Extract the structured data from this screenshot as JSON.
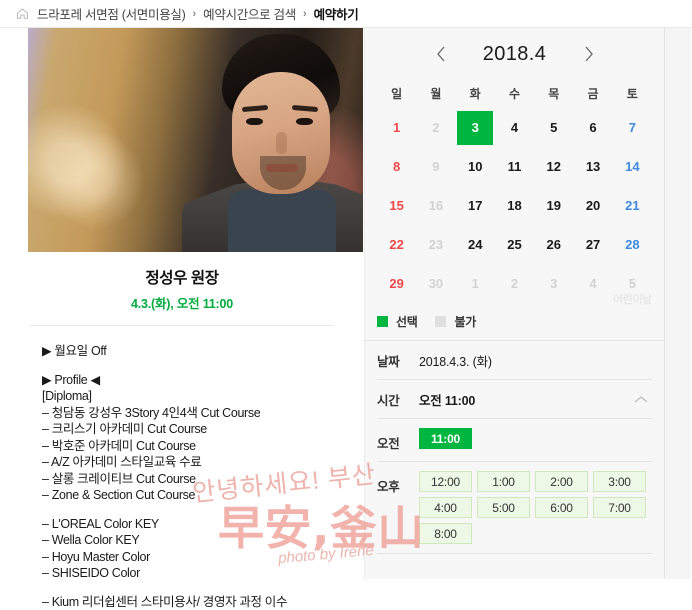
{
  "breadcrumb": {
    "home_icon": "home-icon",
    "separator": "›",
    "items": [
      {
        "label": "드라포레 서면점 (서면미용실)",
        "current": false
      },
      {
        "label": "예약시간으로 검색",
        "current": false
      },
      {
        "label": "예약하기",
        "current": true
      }
    ]
  },
  "stylist": {
    "photo_alt": "stylist-portrait",
    "name": "정성우 원장",
    "selected_slot": "4.3.(화), 오전 11:00",
    "notice": "▶ 월요일 Off",
    "profile_heading": "▶ Profile ◀",
    "profile_lines": [
      "[Diploma]",
      "– 청담동 강성우 3Story 4인4색 Cut Course",
      "– 크리스기 아카데미 Cut Course",
      "– 박호준 아카데미 Cut Course",
      "– A/Z 아카데미 스타일교육 수료",
      "– 살롱 크레이티브 Cut Course",
      "– Zone & Section Cut Course",
      "",
      "– L'OREAL Color KEY",
      "– Wella Color KEY",
      "– Hoyu Master Color",
      "– SHISEIDO Color",
      "",
      "– Kium 리더쉽센터 스타미용사/ 경영자 과정 이수"
    ]
  },
  "watermark": {
    "line_korean": "안녕하세요! 부산",
    "line_chinese": "早安,釜山",
    "line_credit": "photo by Irene"
  },
  "calendar": {
    "prev_icon": "chevron-left-icon",
    "next_icon": "chevron-right-icon",
    "title": "2018.4",
    "day_headers": [
      "일",
      "월",
      "화",
      "수",
      "목",
      "금",
      "토"
    ],
    "weeks": [
      [
        {
          "day": "1",
          "state": "sun"
        },
        {
          "day": "2",
          "state": "dim"
        },
        {
          "day": "3",
          "state": "sel"
        },
        {
          "day": "4",
          "state": "norm"
        },
        {
          "day": "5",
          "state": "norm"
        },
        {
          "day": "6",
          "state": "norm"
        },
        {
          "day": "7",
          "state": "sat"
        }
      ],
      [
        {
          "day": "8",
          "state": "sun"
        },
        {
          "day": "9",
          "state": "dim"
        },
        {
          "day": "10",
          "state": "norm"
        },
        {
          "day": "11",
          "state": "norm"
        },
        {
          "day": "12",
          "state": "norm"
        },
        {
          "day": "13",
          "state": "norm"
        },
        {
          "day": "14",
          "state": "sat"
        }
      ],
      [
        {
          "day": "15",
          "state": "sun"
        },
        {
          "day": "16",
          "state": "dim"
        },
        {
          "day": "17",
          "state": "norm"
        },
        {
          "day": "18",
          "state": "norm"
        },
        {
          "day": "19",
          "state": "norm"
        },
        {
          "day": "20",
          "state": "norm"
        },
        {
          "day": "21",
          "state": "sat"
        }
      ],
      [
        {
          "day": "22",
          "state": "sun"
        },
        {
          "day": "23",
          "state": "dim"
        },
        {
          "day": "24",
          "state": "norm"
        },
        {
          "day": "25",
          "state": "norm"
        },
        {
          "day": "26",
          "state": "norm"
        },
        {
          "day": "27",
          "state": "norm"
        },
        {
          "day": "28",
          "state": "sat"
        }
      ],
      [
        {
          "day": "29",
          "state": "sun"
        },
        {
          "day": "30",
          "state": "dim"
        },
        {
          "day": "1",
          "state": "dim"
        },
        {
          "day": "2",
          "state": "dim"
        },
        {
          "day": "3",
          "state": "dim"
        },
        {
          "day": "4",
          "state": "dim"
        },
        {
          "day": "5",
          "state": "dim",
          "holiday": "어린이날"
        }
      ]
    ],
    "legend": [
      {
        "swatch": "sel",
        "label": "선택"
      },
      {
        "swatch": "dis",
        "label": "불가"
      }
    ]
  },
  "booking": {
    "date_label": "날짜",
    "date_value": "2018.4.3. (화)",
    "time_label": "시간",
    "time_value": "오전 11:00",
    "collapse_icon": "chevron-up-icon",
    "am_label": "오전",
    "am_slots": [
      {
        "time": "11:00",
        "state": "sel"
      }
    ],
    "pm_label": "오후",
    "pm_slots": [
      {
        "time": "12:00",
        "state": "avail"
      },
      {
        "time": "1:00",
        "state": "avail"
      },
      {
        "time": "2:00",
        "state": "avail"
      },
      {
        "time": "3:00",
        "state": "avail"
      },
      {
        "time": "4:00",
        "state": "avail"
      },
      {
        "time": "5:00",
        "state": "avail"
      },
      {
        "time": "6:00",
        "state": "avail"
      },
      {
        "time": "7:00",
        "state": "avail"
      },
      {
        "time": "8:00",
        "state": "avail"
      }
    ]
  },
  "colors": {
    "accent_green": "#00b540",
    "slot_available_bg": "#eef8e6",
    "slot_available_border": "#cfe8bd",
    "sunday_red": "#f04848",
    "saturday_blue": "#3f8ae0",
    "panel_bg": "#f7f7f7"
  }
}
